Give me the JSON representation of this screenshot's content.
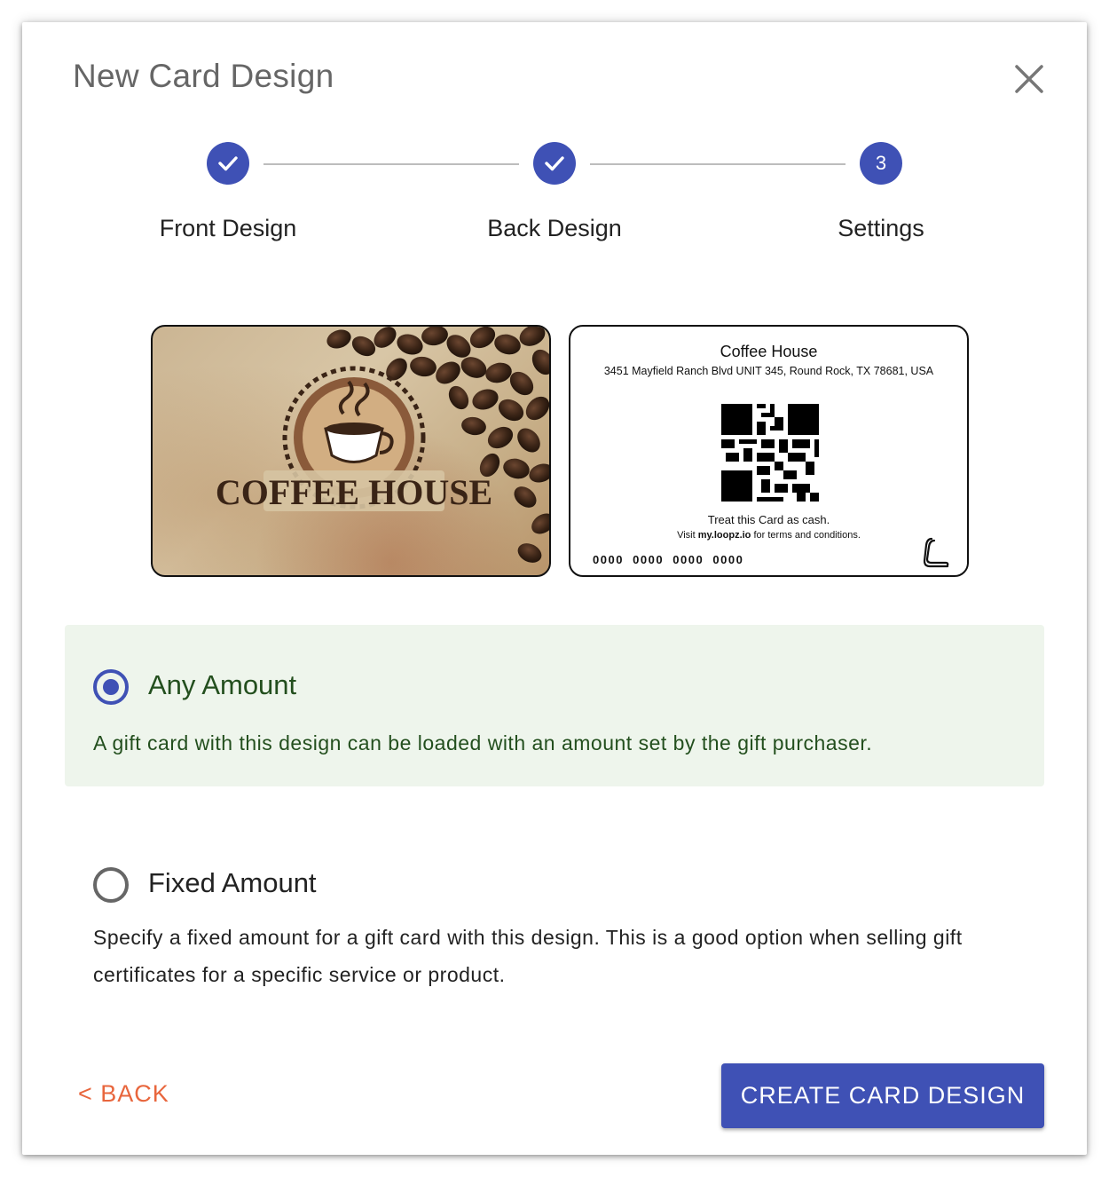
{
  "dialog": {
    "title": "New Card Design",
    "close_icon": "close-icon"
  },
  "stepper": {
    "steps": [
      {
        "label": "Front Design",
        "state": "complete",
        "icon": "check-icon"
      },
      {
        "label": "Back Design",
        "state": "complete",
        "icon": "check-icon"
      },
      {
        "label": "Settings",
        "state": "active",
        "number": "3"
      }
    ],
    "active_color": "#3f51b5"
  },
  "card_front": {
    "logo_text": "COFFEE HOUSE",
    "icon": "coffee-cup-icon"
  },
  "card_back": {
    "business_name": "Coffee House",
    "address": "3451 Mayfield Ranch Blvd UNIT 345, Round Rock, TX 78681, USA",
    "qr_icon": "qr-code-icon",
    "cash_notice": "Treat this Card as cash.",
    "visit_prefix": "Visit",
    "visit_site": "my.loopz.io",
    "visit_suffix": "for terms and conditions.",
    "card_number": "0000  0000  0000  0000",
    "brand_icon": "loopz-logo-icon"
  },
  "options": {
    "any_amount": {
      "label": "Any Amount",
      "description": "A gift card with this design can be loaded with an amount set by the gift purchaser.",
      "selected": true,
      "background": "#eef5ec",
      "text_color": "#234f1e"
    },
    "fixed_amount": {
      "label": "Fixed Amount",
      "description": "Specify a fixed amount for a gift card with this design. This is a good option when selling gift certificates for a specific service or product.",
      "selected": false
    }
  },
  "actions": {
    "back_label": "< BACK",
    "back_color": "#e8663d",
    "create_label": "CREATE CARD DESIGN",
    "create_color": "#3f51b5"
  }
}
